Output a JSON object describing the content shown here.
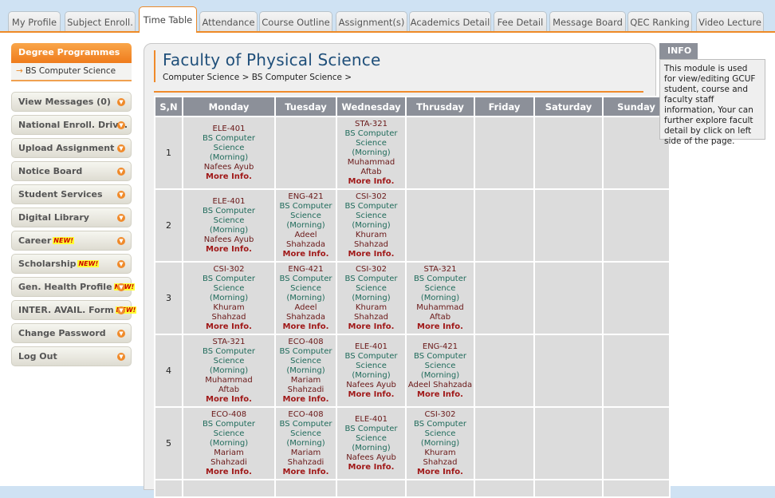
{
  "tabs": [
    {
      "label": "My Profile",
      "active": false
    },
    {
      "label": "Subject Enroll.",
      "active": false
    },
    {
      "label": "Time Table",
      "active": true
    },
    {
      "label": "Attendance",
      "active": false
    },
    {
      "label": "Course Outline",
      "active": false
    },
    {
      "label": "Assignment(s)",
      "active": false
    },
    {
      "label": "Academics Detail",
      "active": false
    },
    {
      "label": "Fee Detail",
      "active": false
    },
    {
      "label": "Message Board",
      "active": false
    },
    {
      "label": "QEC Ranking",
      "active": false
    },
    {
      "label": "Video Lecture",
      "active": false
    }
  ],
  "sidebar": {
    "degree_header": "Degree Programmes",
    "degree_item": "BS Computer Science",
    "menu": [
      {
        "label": "View Messages (0)",
        "new": false
      },
      {
        "label": "National Enroll. Drive.",
        "new": false
      },
      {
        "label": "Upload Assignment",
        "new": false
      },
      {
        "label": "Notice Board",
        "new": false
      },
      {
        "label": "Student Services",
        "new": false
      },
      {
        "label": "Digital Library",
        "new": false
      },
      {
        "label": "Career",
        "new": true
      },
      {
        "label": "Scholarship",
        "new": true
      },
      {
        "label": "Gen. Health Profile",
        "new": true
      },
      {
        "label": "INTER. AVAIL. Form",
        "new": true
      },
      {
        "label": "Change Password",
        "new": false
      },
      {
        "label": "Log Out",
        "new": false
      }
    ],
    "new_badge": "NEW!"
  },
  "main": {
    "title": "Faculty of Physical Science",
    "breadcrumb": "Computer Science > BS Computer Science >"
  },
  "timetable": {
    "headers": [
      "S,N",
      "Monday",
      "Tuesday",
      "Wednesday",
      "Thrusday",
      "Friday",
      "Saturday",
      "Sunday"
    ],
    "more_label": "More Info.",
    "rows": [
      {
        "sn": "1",
        "cells": [
          {
            "code": "ELE-401",
            "prog": [
              "BS Computer",
              "Science",
              "(Morning)"
            ],
            "fac": [
              "Nafees Ayub"
            ]
          },
          null,
          {
            "code": "STA-321",
            "prog": [
              "BS Computer",
              "Science",
              "(Morning)"
            ],
            "fac": [
              "Muhammad",
              "Aftab"
            ]
          },
          null,
          null,
          null,
          null
        ]
      },
      {
        "sn": "2",
        "cells": [
          {
            "code": "ELE-401",
            "prog": [
              "BS Computer",
              "Science",
              "(Morning)"
            ],
            "fac": [
              "Nafees Ayub"
            ]
          },
          {
            "code": "ENG-421",
            "prog": [
              "BS Computer",
              "Science",
              "(Morning)"
            ],
            "fac": [
              "Adeel",
              "Shahzada"
            ]
          },
          {
            "code": "CSI-302",
            "prog": [
              "BS Computer",
              "Science",
              "(Morning)"
            ],
            "fac": [
              "Khuram Shahzad"
            ]
          },
          null,
          null,
          null,
          null
        ]
      },
      {
        "sn": "3",
        "cells": [
          {
            "code": "CSI-302",
            "prog": [
              "BS Computer",
              "Science",
              "(Morning)"
            ],
            "fac": [
              "Khuram",
              "Shahzad"
            ]
          },
          {
            "code": "ENG-421",
            "prog": [
              "BS Computer",
              "Science",
              "(Morning)"
            ],
            "fac": [
              "Adeel",
              "Shahzada"
            ]
          },
          {
            "code": "CSI-302",
            "prog": [
              "BS Computer",
              "Science",
              "(Morning)"
            ],
            "fac": [
              "Khuram Shahzad"
            ]
          },
          {
            "code": "STA-321",
            "prog": [
              "BS Computer",
              "Science",
              "(Morning)"
            ],
            "fac": [
              "Muhammad",
              "Aftab"
            ]
          },
          null,
          null,
          null
        ]
      },
      {
        "sn": "4",
        "cells": [
          {
            "code": "STA-321",
            "prog": [
              "BS Computer",
              "Science",
              "(Morning)"
            ],
            "fac": [
              "Muhammad",
              "Aftab"
            ]
          },
          {
            "code": "ECO-408",
            "prog": [
              "BS Computer",
              "Science",
              "(Morning)"
            ],
            "fac": [
              "Mariam",
              "Shahzadi"
            ]
          },
          {
            "code": "ELE-401",
            "prog": [
              "BS Computer",
              "Science",
              "(Morning)"
            ],
            "fac": [
              "Nafees Ayub"
            ]
          },
          {
            "code": "ENG-421",
            "prog": [
              "BS Computer",
              "Science",
              "(Morning)"
            ],
            "fac": [
              "Adeel Shahzada"
            ]
          },
          null,
          null,
          null
        ]
      },
      {
        "sn": "5",
        "cells": [
          {
            "code": "ECO-408",
            "prog": [
              "BS Computer",
              "Science",
              "(Morning)"
            ],
            "fac": [
              "Mariam",
              "Shahzadi"
            ]
          },
          {
            "code": "ECO-408",
            "prog": [
              "BS Computer",
              "Science",
              "(Morning)"
            ],
            "fac": [
              "Mariam",
              "Shahzadi"
            ]
          },
          {
            "code": "ELE-401",
            "prog": [
              "BS Computer",
              "Science",
              "(Morning)"
            ],
            "fac": [
              "Nafees Ayub"
            ]
          },
          {
            "code": "CSI-302",
            "prog": [
              "BS Computer",
              "Science",
              "(Morning)"
            ],
            "fac": [
              "Khuram",
              "Shahzad"
            ]
          },
          null,
          null,
          null
        ]
      }
    ]
  },
  "info": {
    "heading": "INFO",
    "text": "This module is used for view/editing GCUF student, course and faculty staff information, Your can further explore facult detail by click on left side of the page."
  }
}
